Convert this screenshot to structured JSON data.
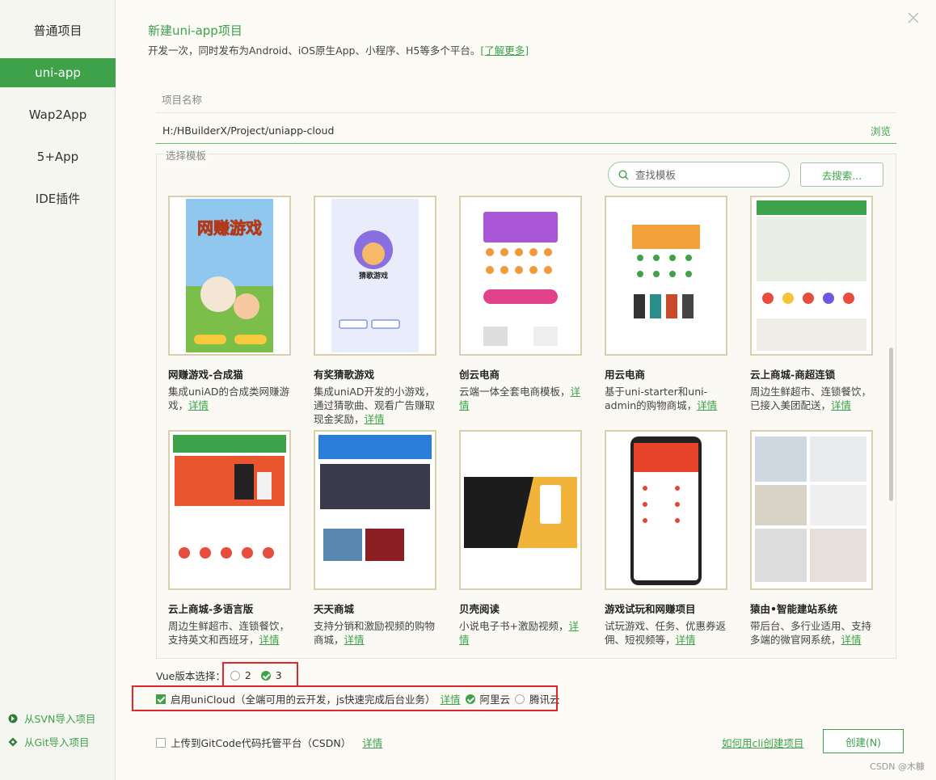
{
  "sidebar": {
    "items": [
      {
        "label": "普通项目",
        "active": false
      },
      {
        "label": "uni-app",
        "active": true
      },
      {
        "label": "Wap2App",
        "active": false
      },
      {
        "label": "5+App",
        "active": false
      },
      {
        "label": "IDE插件",
        "active": false
      }
    ],
    "import_svn": "从SVN导入项目",
    "import_git": "从Git导入项目"
  },
  "header": {
    "title": "新建uni-app项目",
    "subtitle": "开发一次，同时发布为Android、iOS原生App、小程序、H5等多个平台。",
    "learn_more": "[了解更多]"
  },
  "project": {
    "name_label": "项目名称",
    "path_value": "H:/HBuilderX/Project/uniapp-cloud",
    "browse": "浏览"
  },
  "templates": {
    "legend": "选择模板",
    "search_placeholder": "查找模板",
    "go_search": "去搜索...",
    "detail_text": "详情",
    "items": [
      {
        "title": "网赚游戏-合成猫",
        "desc": "集成uniAD的合成类网赚游戏，"
      },
      {
        "title": "有奖猜歌游戏",
        "desc": "集成uniAD开发的小游戏，通过猜歌曲、观看广告赚取现金奖励，"
      },
      {
        "title": "创云电商",
        "desc": "云端一体全套电商模板，"
      },
      {
        "title": "用云电商",
        "desc": "基于uni-starter和uni-admin的购物商城，"
      },
      {
        "title": "云上商城-商超连锁",
        "desc": "周边生鲜超市、连锁餐饮，已接入美团配送，"
      },
      {
        "title": "云上商城-多语言版",
        "desc": "周边生鲜超市、连锁餐饮，支持英文和西班牙，"
      },
      {
        "title": "天天商城",
        "desc": "支持分销和激励视频的购物商城，"
      },
      {
        "title": "贝壳阅读",
        "desc": "小说电子书+激励视频，"
      },
      {
        "title": "游戏试玩和网赚项目",
        "desc": "试玩游戏、任务、优惠券返佣、短视频等，"
      },
      {
        "title": "猿由•智能建站系统",
        "desc": "带后台、多行业适用、支持多端的微官网系统，"
      }
    ]
  },
  "vue": {
    "label": "Vue版本选择：",
    "options": [
      {
        "label": "2",
        "selected": false
      },
      {
        "label": "3",
        "selected": true
      }
    ]
  },
  "unicloud": {
    "checked": true,
    "label": "启用uniCloud（全端可用的云开发，js快速完成后台业务）",
    "detail": "详情",
    "providers": [
      {
        "label": "阿里云",
        "selected": true
      },
      {
        "label": "腾讯云",
        "selected": false
      }
    ]
  },
  "gitcode": {
    "checked": false,
    "label": "上传到GitCode代码托管平台（CSDN）",
    "detail": "详情"
  },
  "footer": {
    "cli_link": "如何用cli创建项目",
    "create": "创建(N)",
    "watermark": "CSDN @木糠"
  },
  "colors": {
    "accent": "#3ea24b",
    "highlight": "#e0282f"
  }
}
